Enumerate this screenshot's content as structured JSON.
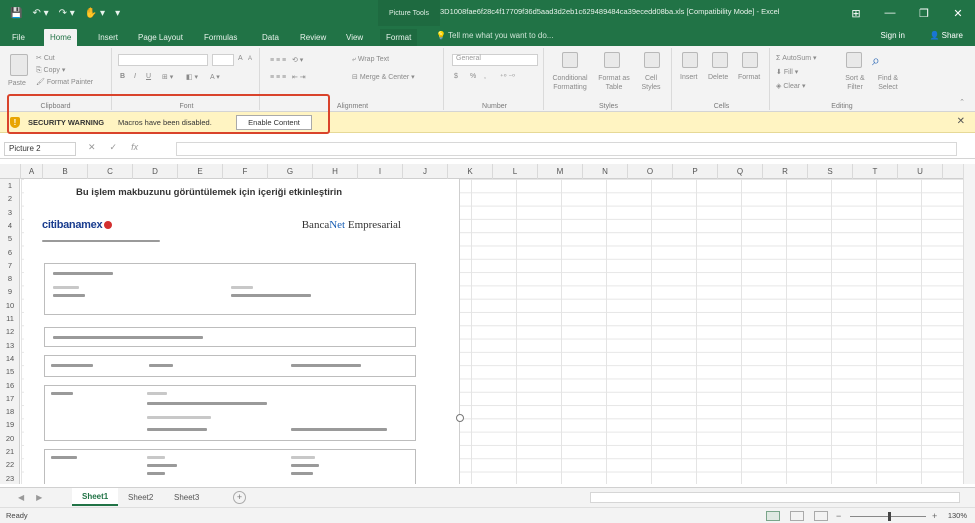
{
  "titlebar": {
    "quick_access": [
      "💾",
      "↶ ▾",
      "↷ ▾",
      "✋ ▾",
      "▾"
    ],
    "contextual_group": "Picture Tools",
    "title": "3D1008fae6f28c4f17709f36d5aad3d2eb1c629489484ca39ecedd08ba.xls [Compatibility Mode] - Excel",
    "window_buttons": [
      "⊞",
      "—",
      "❐",
      "✕"
    ]
  },
  "tabs": {
    "file": "File",
    "items": [
      "Home",
      "Insert",
      "Page Layout",
      "Formulas",
      "Data",
      "Review",
      "View"
    ],
    "active": "Home",
    "contextual": "Format",
    "tell_me": "Tell me what you want to do...",
    "sign_in": "Sign in",
    "share": "Share"
  },
  "ribbon": {
    "clipboard": {
      "paste": "Paste",
      "cut": "Cut",
      "copy": "Copy",
      "format_painter": "Format Painter",
      "label": "Clipboard"
    },
    "font": {
      "label": "Font",
      "bold": "B",
      "italic": "I",
      "underline": "U",
      "grow": "A",
      "shrink": "A"
    },
    "alignment": {
      "wrap_text": "Wrap Text",
      "merge_center": "Merge & Center",
      "label": "Alignment"
    },
    "number": {
      "format": "General",
      "currency": "$",
      "percent": "%",
      "comma": ",",
      "label": "Number"
    },
    "styles": {
      "conditional": "Conditional Formatting",
      "format_as_table": "Format as Table",
      "cell_styles": "Cell Styles",
      "label": "Styles"
    },
    "cells": {
      "insert": "Insert",
      "delete": "Delete",
      "format": "Format",
      "label": "Cells"
    },
    "editing": {
      "autosum": "AutoSum",
      "fill": "Fill",
      "clear": "Clear",
      "sort_filter": "Sort & Filter",
      "find_select": "Find & Select",
      "label": "Editing"
    }
  },
  "security_bar": {
    "title": "SECURITY WARNING",
    "message": "Macros have been disabled.",
    "button": "Enable Content",
    "close": "✕"
  },
  "formula_bar": {
    "name_box": "Picture 2",
    "cancel": "✕",
    "enter": "✓",
    "fx": "fx",
    "value": ""
  },
  "columns": [
    "A",
    "B",
    "C",
    "D",
    "E",
    "F",
    "G",
    "H",
    "I",
    "J",
    "K",
    "L",
    "M",
    "N",
    "O",
    "P",
    "Q",
    "R",
    "S",
    "T",
    "U"
  ],
  "rows": [
    "1",
    "2",
    "3",
    "4",
    "5",
    "6",
    "7",
    "8",
    "9",
    "10",
    "11",
    "12",
    "13",
    "14",
    "15",
    "16",
    "17",
    "18",
    "19",
    "20",
    "21",
    "22",
    "23"
  ],
  "picture": {
    "heading": "Bu işlem makbuzunu görüntülemek için içeriği etkinleştirin",
    "logo_text": "citibanamex",
    "brand_prefix": "Banca",
    "brand_mid": "Net",
    "brand_suffix": " Empresarial"
  },
  "sheets": {
    "tabs": [
      "Sheet1",
      "Sheet2",
      "Sheet3"
    ],
    "active": "Sheet1",
    "add": "+"
  },
  "status": {
    "left": "Ready",
    "zoom_minus": "−",
    "zoom_plus": "+",
    "zoom_level": "130%"
  }
}
